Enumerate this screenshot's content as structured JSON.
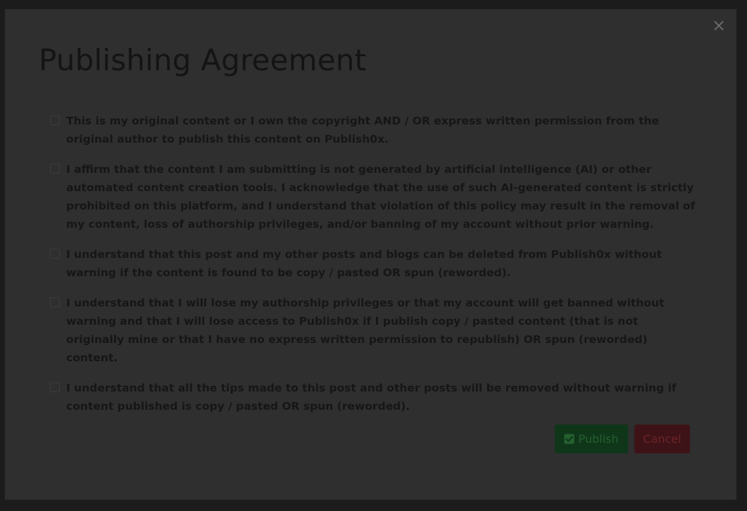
{
  "modal": {
    "title": "Publishing Agreement",
    "close_label": "×",
    "items": [
      {
        "label": "This is my original content or I own the copyright AND / OR express written permission from the original author to publish this content on Publish0x.",
        "checked": false
      },
      {
        "label": "I affirm that the content I am submitting is not generated by artificial intelligence (AI) or other automated content creation tools. I acknowledge that the use of such AI-generated content is strictly prohibited on this platform, and I understand that violation of this policy may result in the removal of my content, loss of authorship privileges, and/or banning of my account without prior warning.",
        "checked": false
      },
      {
        "label": "I understand that this post and my other posts and blogs can be deleted from Publish0x without warning if the content is found to be copy / pasted OR spun (reworded).",
        "checked": false
      },
      {
        "label": "I understand that I will lose my authorship privileges or that my account will get banned without warning and that I will lose access to Publish0x if I publish copy / pasted content (that is not originally mine or that I have no express written permission to republish) OR spun (reworded) content.",
        "checked": false
      },
      {
        "label": "I understand that all the tips made to this post and other posts will be removed without warning if content published is copy / pasted OR spun (reworded).",
        "checked": false
      }
    ],
    "buttons": {
      "publish_label": "Publish",
      "publish_icon": "check-square-icon",
      "cancel_label": "Cancel"
    }
  },
  "colors": {
    "backdrop": "#1c1c1c",
    "modal_bg": "#2f2f2f",
    "publish_bg": "#10361a",
    "cancel_bg": "#3d1317"
  }
}
